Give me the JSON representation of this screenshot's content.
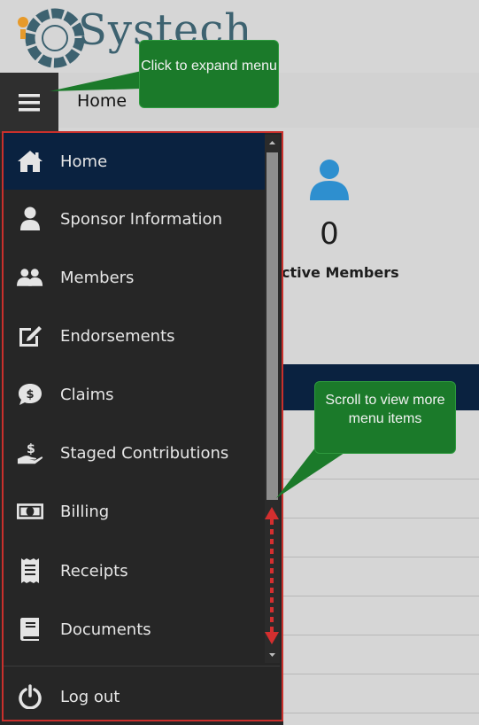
{
  "brand": {
    "logo_text": "Systech"
  },
  "header": {
    "title": "Home",
    "menu_icon": "hamburger-icon"
  },
  "stat": {
    "value": "0",
    "label": "ctive Members",
    "icon": "user-icon",
    "icon_color": "#2e8fcf"
  },
  "sidebar": {
    "active_color": "#0a2240",
    "items": [
      {
        "label": "Home",
        "icon": "home-icon",
        "active": true
      },
      {
        "label": "Sponsor Information",
        "icon": "user-icon"
      },
      {
        "label": "Members",
        "icon": "users-icon"
      },
      {
        "label": "Endorsements",
        "icon": "edit-icon"
      },
      {
        "label": "Claims",
        "icon": "dollar-chat-icon"
      },
      {
        "label": "Staged Contributions",
        "icon": "hand-dollar-icon"
      },
      {
        "label": "Billing",
        "icon": "money-bill-icon"
      },
      {
        "label": "Receipts",
        "icon": "receipt-icon"
      },
      {
        "label": "Documents",
        "icon": "book-icon"
      }
    ],
    "logout": {
      "label": "Log out",
      "icon": "power-icon"
    }
  },
  "callouts": {
    "expand": "Click to expand menu",
    "scroll": "Scroll to view more menu items"
  }
}
